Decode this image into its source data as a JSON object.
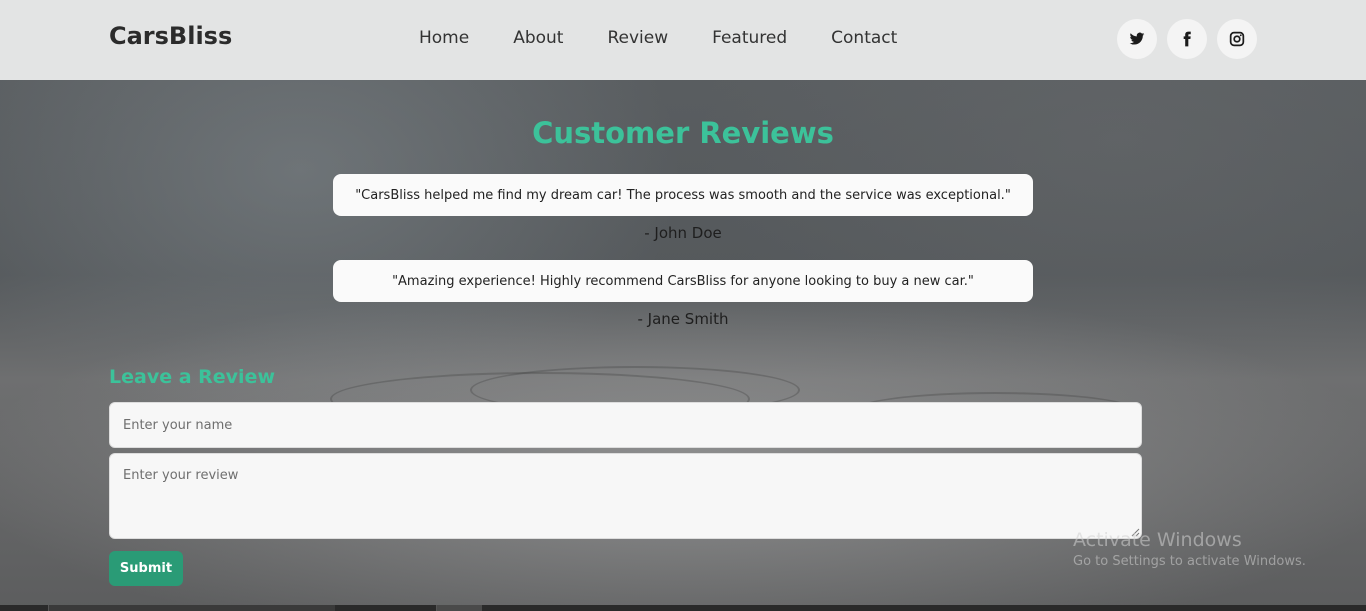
{
  "header": {
    "logo": "CarsBliss",
    "nav": [
      "Home",
      "About",
      "Review",
      "Featured",
      "Contact"
    ],
    "socials": [
      "twitter-icon",
      "facebook-icon",
      "instagram-icon"
    ]
  },
  "reviews": {
    "title": "Customer Reviews",
    "items": [
      {
        "text": "\"CarsBliss helped me find my dream car! The process was smooth and the service was exceptional.\"",
        "author": "- John Doe"
      },
      {
        "text": "\"Amazing experience! Highly recommend CarsBliss for anyone looking to buy a new car.\"",
        "author": "- Jane Smith"
      }
    ]
  },
  "form": {
    "title": "Leave a Review",
    "name_placeholder": "Enter your name",
    "review_placeholder": "Enter your review",
    "submit_label": "Submit"
  },
  "watermark": {
    "line1": "Activate Windows",
    "line2": "Go to Settings to activate Windows."
  },
  "colors": {
    "accent": "#3cc29a",
    "button": "#2a9b76"
  }
}
